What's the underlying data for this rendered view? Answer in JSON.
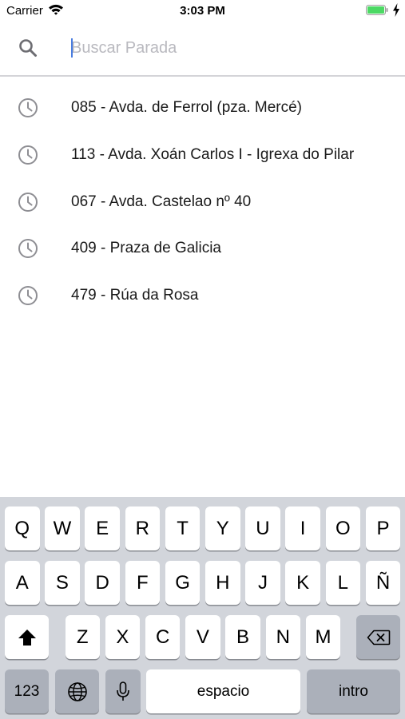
{
  "status_bar": {
    "carrier": "Carrier",
    "time": "3:03 PM",
    "battery_color": "#4cd964"
  },
  "search": {
    "placeholder": "Buscar Parada",
    "value": "",
    "icon": "search-icon"
  },
  "recent_stops": [
    {
      "label": "085 - Avda. de Ferrol (pza. Mercé)",
      "icon": "clock-icon"
    },
    {
      "label": "113 - Avda. Xoán Carlos I - Igrexa do Pilar",
      "icon": "clock-icon"
    },
    {
      "label": "067 - Avda. Castelao nº 40",
      "icon": "clock-icon"
    },
    {
      "label": "409 - Praza de Galicia",
      "icon": "clock-icon"
    },
    {
      "label": "479 - Rúa da Rosa",
      "icon": "clock-icon"
    }
  ],
  "keyboard": {
    "row1": [
      "Q",
      "W",
      "E",
      "R",
      "T",
      "Y",
      "U",
      "I",
      "O",
      "P"
    ],
    "row2": [
      "A",
      "S",
      "D",
      "F",
      "G",
      "H",
      "J",
      "K",
      "L",
      "Ñ"
    ],
    "row3": [
      "Z",
      "X",
      "C",
      "V",
      "B",
      "N",
      "M"
    ],
    "shift_icon": "shift-icon",
    "delete_icon": "delete-icon",
    "numbers_label": "123",
    "globe_icon": "globe-icon",
    "mic_icon": "microphone-icon",
    "space_label": "espacio",
    "return_label": "intro"
  }
}
